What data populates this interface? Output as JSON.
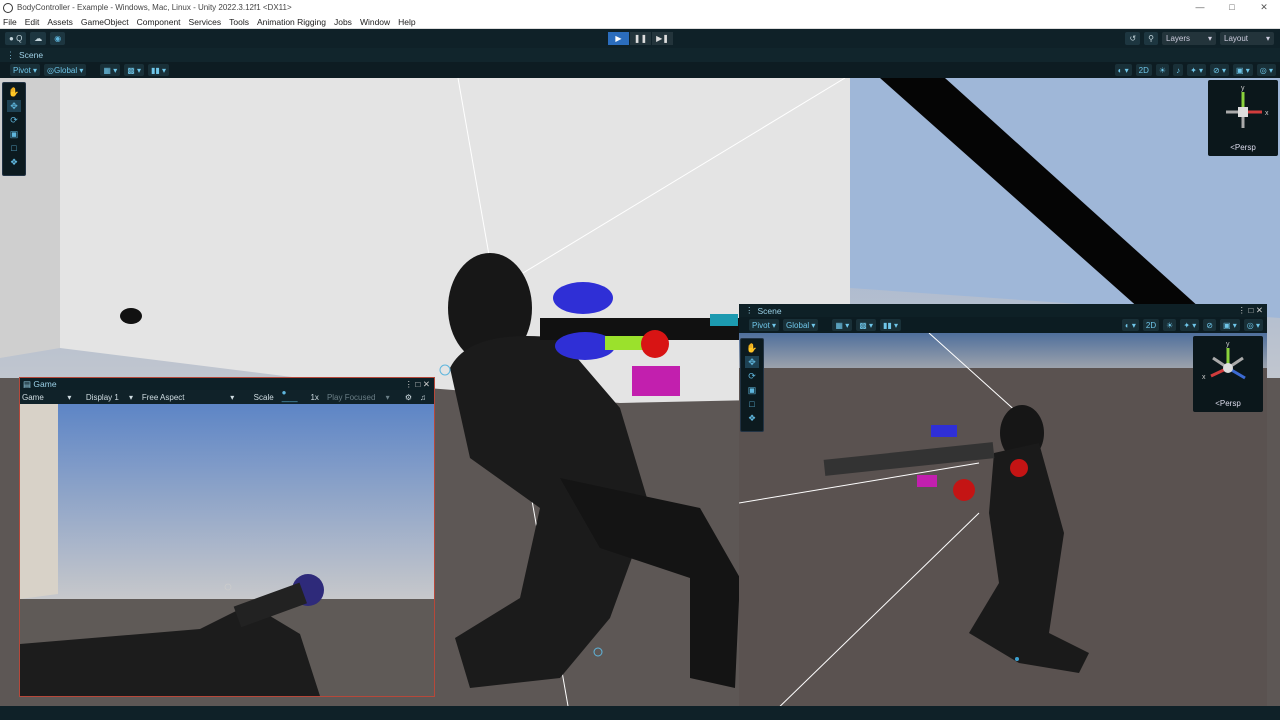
{
  "title_bar": {
    "title": "BodyController - Example - Windows, Mac, Linux - Unity 2022.3.12f1 <DX11>",
    "controls": [
      "—",
      "□",
      "✕"
    ]
  },
  "menu": [
    "File",
    "Edit",
    "Assets",
    "GameObject",
    "Component",
    "Services",
    "Tools",
    "Animation Rigging",
    "Jobs",
    "Window",
    "Help"
  ],
  "toolbar": {
    "account": "Q",
    "play": "▶",
    "pause": "❚❚",
    "step": "▶❚",
    "layers": "Layers",
    "layout": "Layout"
  },
  "scene_tab": {
    "title": "Scene",
    "pivot": "Pivot",
    "global": "Global",
    "mode_2d": "2D",
    "persp": "Persp"
  },
  "game_window": {
    "title": "Game",
    "view_mode": "Game",
    "display": "Display 1",
    "aspect": "Free Aspect",
    "scale_label": "Scale",
    "scale_value": "1x",
    "play_mode": "Play Focused"
  },
  "scene_window_2": {
    "title": "Scene",
    "pivot": "Pivot",
    "global": "Global",
    "mode_2d": "2D",
    "persp": "Persp"
  },
  "colors": {
    "accent": "#2b6dbd",
    "tool_icon": "#5fb6dd",
    "editor_bg": "#0f2128"
  }
}
